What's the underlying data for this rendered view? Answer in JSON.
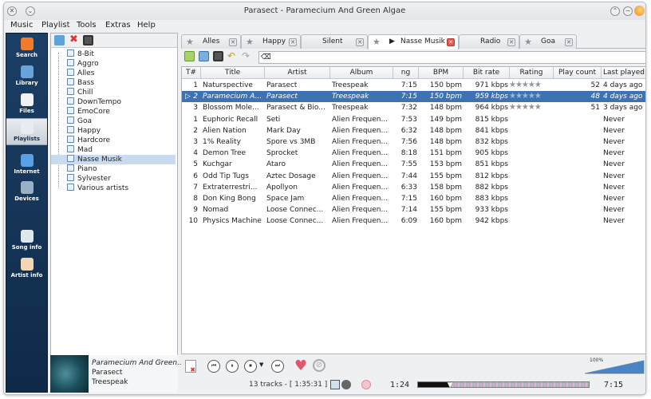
{
  "window": {
    "title": "Parasect - Paramecium And Green Algae"
  },
  "menu": [
    "Music",
    "Playlist",
    "Tools",
    "Extras",
    "Help"
  ],
  "nav": [
    {
      "label": "Search",
      "icon": "search-icon"
    },
    {
      "label": "Library",
      "icon": "library-icon"
    },
    {
      "label": "Files",
      "icon": "folder-icon"
    },
    {
      "label": "Playlists",
      "icon": "playlist-icon",
      "active": true
    },
    {
      "label": "Internet",
      "icon": "globe-icon"
    },
    {
      "label": "Devices",
      "icon": "device-icon"
    },
    {
      "label": "Song info",
      "icon": "song-info-icon"
    },
    {
      "label": "Artist info",
      "icon": "artist-icon"
    }
  ],
  "playlists": [
    "8-Bit",
    "Aggro",
    "Alles",
    "Bass",
    "Chill",
    "DownTempo",
    "EmoCore",
    "Goa",
    "Happy",
    "Hardcore",
    "Mad",
    "Nasse Musik",
    "Piano",
    "Sylvester",
    "Various artists"
  ],
  "selected_playlist": "Nasse Musik",
  "tabs": [
    {
      "label": "Alles",
      "starred": true
    },
    {
      "label": "Happy",
      "starred": true
    },
    {
      "label": "Silent",
      "starred": false
    },
    {
      "label": "Nasse Musik",
      "starred": true,
      "active": true,
      "playing": true
    },
    {
      "label": "Radio",
      "starred": false
    },
    {
      "label": "Goa",
      "starred": true
    }
  ],
  "columns": [
    "T#",
    "Title",
    "Artist",
    "Album",
    "ng",
    "BPM",
    "Bit rate",
    "Rating",
    "Play count",
    "Last played"
  ],
  "tracks": [
    {
      "n": "1",
      "title": "Naturspective",
      "artist": "Parasect",
      "album": "Treespeak",
      "len": "7:15",
      "bpm": "150 bpm",
      "bitrate": "971 kbps",
      "stars": 5,
      "plays": "52",
      "last": "4 days ago"
    },
    {
      "n": "2",
      "title": "Paramecium A...",
      "artist": "Parasect",
      "album": "Treespeak",
      "len": "7:15",
      "bpm": "150 bpm",
      "bitrate": "959 kbps",
      "stars": 5,
      "plays": "48",
      "last": "4 days ago",
      "playing": true
    },
    {
      "n": "3",
      "title": "Blossom Mole...",
      "artist": "Parasect & Bio...",
      "album": "Treespeak",
      "len": "7:32",
      "bpm": "148 bpm",
      "bitrate": "964 kbps",
      "stars": 5,
      "plays": "51",
      "last": "3 days ago"
    },
    {
      "n": "1",
      "title": "Euphoric Recall",
      "artist": "Seti",
      "album": "Alien Frequen...",
      "len": "7:53",
      "bpm": "149 bpm",
      "bitrate": "815 kbps",
      "stars": 0,
      "plays": "",
      "last": "Never"
    },
    {
      "n": "2",
      "title": "Alien Nation",
      "artist": "Mark Day",
      "album": "Alien Frequen...",
      "len": "6:32",
      "bpm": "148 bpm",
      "bitrate": "841 kbps",
      "stars": 0,
      "plays": "",
      "last": "Never"
    },
    {
      "n": "3",
      "title": "1% Reality",
      "artist": "Spore vs 3MB",
      "album": "Alien Frequen...",
      "len": "7:56",
      "bpm": "148 bpm",
      "bitrate": "832 kbps",
      "stars": 0,
      "plays": "",
      "last": "Never"
    },
    {
      "n": "4",
      "title": "Demon Tree",
      "artist": "Sprocket",
      "album": "Alien Frequen...",
      "len": "8:18",
      "bpm": "151 bpm",
      "bitrate": "905 kbps",
      "stars": 0,
      "plays": "",
      "last": "Never"
    },
    {
      "n": "5",
      "title": "Kuchgar",
      "artist": "Ataro",
      "album": "Alien Frequen...",
      "len": "7:55",
      "bpm": "153 bpm",
      "bitrate": "851 kbps",
      "stars": 0,
      "plays": "",
      "last": "Never"
    },
    {
      "n": "6",
      "title": "Odd Tip Tugs",
      "artist": "Aztec Dosage",
      "album": "Alien Frequen...",
      "len": "7:44",
      "bpm": "155 bpm",
      "bitrate": "812 kbps",
      "stars": 0,
      "plays": "",
      "last": "Never"
    },
    {
      "n": "7",
      "title": "Extraterrestri...",
      "artist": "Apollyon",
      "album": "Alien Frequen...",
      "len": "6:33",
      "bpm": "158 bpm",
      "bitrate": "882 kbps",
      "stars": 0,
      "plays": "",
      "last": "Never"
    },
    {
      "n": "8",
      "title": "Don King Bong",
      "artist": "Space Jam",
      "album": "Alien Frequen...",
      "len": "7:15",
      "bpm": "160 bpm",
      "bitrate": "883 kbps",
      "stars": 0,
      "plays": "",
      "last": "Never"
    },
    {
      "n": "9",
      "title": "Nomad",
      "artist": "Loose Connec...",
      "album": "Alien Frequen...",
      "len": "7:14",
      "bpm": "155 bpm",
      "bitrate": "933 kbps",
      "stars": 0,
      "plays": "",
      "last": "Never"
    },
    {
      "n": "10",
      "title": "Physics Machine",
      "artist": "Loose Connec...",
      "album": "Alien Frequen...",
      "len": "6:09",
      "bpm": "160 bpm",
      "bitrate": "942 kbps",
      "stars": 0,
      "plays": "",
      "last": "Never"
    }
  ],
  "now_playing": {
    "title": "Paramecium And Green...",
    "artist": "Parasect",
    "album": "Treespeak"
  },
  "status": {
    "track_count": "13 tracks - [ 1:35:31 ]",
    "elapsed": "1:24",
    "total": "7:15",
    "progress": 0.19
  },
  "volume": {
    "label": "100%",
    "level": 1.0
  },
  "colors": {
    "accent": "#3d73b3",
    "nav_bg": "#1c3f66",
    "love": "#e0576d"
  }
}
